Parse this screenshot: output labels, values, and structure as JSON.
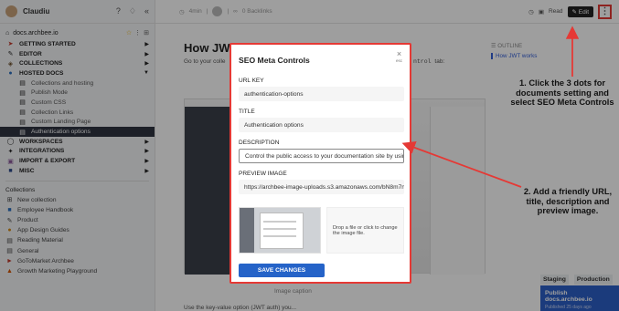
{
  "sidebar": {
    "user": "Claudiu",
    "workspace": "docs.archbee.io",
    "items": [
      {
        "label": "GETTING STARTED",
        "icon": "rocket-icon"
      },
      {
        "label": "EDITOR",
        "icon": "edit-icon"
      },
      {
        "label": "COLLECTIONS",
        "icon": "stack-icon"
      },
      {
        "label": "HOSTED DOCS",
        "icon": "globe-icon"
      },
      {
        "label": "Collections and hosting"
      },
      {
        "label": "Publish Mode"
      },
      {
        "label": "Custom CSS"
      },
      {
        "label": "Collection Links"
      },
      {
        "label": "Custom Landing Page"
      },
      {
        "label": "Authentication options"
      },
      {
        "label": "WORKSPACES",
        "icon": "workspace-icon"
      },
      {
        "label": "INTEGRATIONS",
        "icon": "pointer-icon"
      },
      {
        "label": "IMPORT & EXPORT",
        "icon": "import-icon"
      },
      {
        "label": "MISC",
        "icon": "misc-icon"
      }
    ],
    "collections_title": "Collections",
    "collections": [
      "New collection",
      "Employee Handbook",
      "Product",
      "App Design Guides",
      "Reading Material",
      "General",
      "GoToMarket Archbee",
      "Growth Marketing Playground"
    ]
  },
  "topbar": {
    "read_time": "4min",
    "backlinks": "0 Backlinks",
    "read_label": "Read",
    "edit_label": "Edit"
  },
  "main": {
    "title": "How JWT",
    "subtitle": "Go to your colle",
    "code": "ntrol",
    "code_suffix": "tab:",
    "caption": "Image caption",
    "bottom_text": "Use the key-value option (JWT auth) you...",
    "outline_header": "OUTLINE",
    "outline_item": "How JWT works",
    "staging": "Staging",
    "production": "Production",
    "publish_title": "Publish docs.archbee.io",
    "publish_sub": "Published 25 days ago"
  },
  "modal": {
    "title": "SEO Meta Controls",
    "close": "×",
    "esc": "esc",
    "url_label": "URL KEY",
    "url_value": "authentication-options",
    "title_label": "TITLE",
    "title_value": "Authentication options",
    "desc_label": "DESCRIPTION",
    "desc_value": "Control the public access to your documentation site by using",
    "image_label": "PREVIEW IMAGE",
    "image_url": "https://archbee-image-uploads.s3.amazonaws.com/bN8m7nl",
    "drop_text": "Drop a file or click to change the image file.",
    "save_label": "SAVE CHANGES"
  },
  "annotations": {
    "one": "1. Click the 3 dots for documents setting and select SEO Meta Controls",
    "two": "2. Add a friendly URL, title, description and preview image."
  },
  "colors": {
    "accent": "#2563c8",
    "annotation": "#e53935",
    "sidebar_active": "#2f3542"
  }
}
